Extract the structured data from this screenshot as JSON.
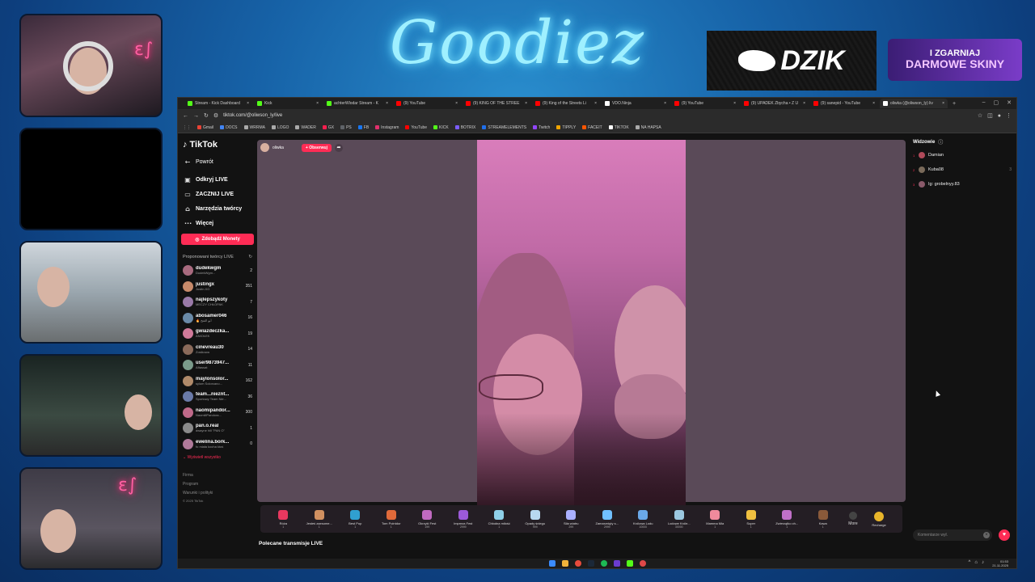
{
  "overlay": {
    "brand": "Goodiez",
    "sponsor": "DZIK",
    "promo_line1": "I ZGARNIAJ",
    "promo_line2": "DARMOWE SKINY",
    "neon_sign": "ɛ∫"
  },
  "browser": {
    "tabs": [
      {
        "label": "Stream - Kick Dashboard",
        "color": "#53fc18"
      },
      {
        "label": "Kick",
        "color": "#53fc18"
      },
      {
        "label": "achterWlodar Stream - K",
        "color": "#53fc18"
      },
      {
        "label": "(9) YouTube",
        "color": "#ff0000"
      },
      {
        "label": "(9) KING OF THE STREE",
        "color": "#ff0000"
      },
      {
        "label": "(9) King of the Streets Li",
        "color": "#ff0000"
      },
      {
        "label": "VDO.Ninja",
        "color": "#ffffff"
      },
      {
        "label": "(9) YouTube",
        "color": "#ff0000"
      },
      {
        "label": "(9) UPADEK Zbycha • Z U",
        "color": "#ff0000"
      },
      {
        "label": "(9) sanepid - YouTube",
        "color": "#ff0000"
      },
      {
        "label": "oliwka (@oliwson_ly) liv",
        "color": "#ffffff"
      }
    ],
    "new_tab": "+",
    "window_controls": [
      "–",
      "▢",
      "✕"
    ],
    "url": "tiktok.com/@oliwson_ly/live",
    "bookmarks": [
      {
        "label": "Gmail",
        "color": "#ea4335"
      },
      {
        "label": "DOCS",
        "color": "#4285f4"
      },
      {
        "label": "WRRMA",
        "color": "#aaaaaa"
      },
      {
        "label": "LOGO",
        "color": "#aaaaaa"
      },
      {
        "label": "WADER",
        "color": "#aaaaaa"
      },
      {
        "label": "GX",
        "color": "#fa1e4e"
      },
      {
        "label": "PS",
        "color": "#5f6368"
      },
      {
        "label": "FB",
        "color": "#1877f2"
      },
      {
        "label": "Instagram",
        "color": "#e1306c"
      },
      {
        "label": "YouTube",
        "color": "#ff0000"
      },
      {
        "label": "KICK",
        "color": "#53fc18"
      },
      {
        "label": "BOTRIX",
        "color": "#7b5cff"
      },
      {
        "label": "STREAMELEMENTS",
        "color": "#1f6feb"
      },
      {
        "label": "Twitch",
        "color": "#9146ff"
      },
      {
        "label": "TIPPLY",
        "color": "#f0a500"
      },
      {
        "label": "FACEIT",
        "color": "#ff5500"
      },
      {
        "label": "TIKTOK",
        "color": "#ffffff"
      },
      {
        "label": "NA HAPSA",
        "color": "#aaaaaa"
      }
    ]
  },
  "tiktok": {
    "logo": "TikTok",
    "back": "Powrót",
    "nav": [
      {
        "label": "Odkryj LIVE",
        "icon": "▣"
      },
      {
        "label": "ZACZNIJ LIVE",
        "icon": "▭"
      },
      {
        "label": "Narzędzia twórcy",
        "icon": "⌂"
      },
      {
        "label": "Więcej",
        "icon": "···"
      }
    ],
    "coins_button": "Zdobądź Monety",
    "suggested_title": "Proponowani twórcy LIVE",
    "creators": [
      {
        "name": "dudekwgm",
        "sub": "DudekWgm...",
        "count": "2"
      },
      {
        "name": "justingx",
        "sub": "Justin.XG",
        "count": "351"
      },
      {
        "name": "najlepszykoty",
        "sub": "MECZY CHŁOPAK",
        "count": "7"
      },
      {
        "name": "abosamer046",
        "sub": "🔥 أبو الفتح",
        "count": "16"
      },
      {
        "name": "gwiazdeczka...",
        "sub": "ANIOŁEK",
        "count": "19"
      },
      {
        "name": "cinevreau30",
        "sub": "Zosikowa",
        "count": "14"
      },
      {
        "name": "user9873947...",
        "sub": "Aftassat",
        "count": "11"
      },
      {
        "name": "maylonsolor...",
        "sub": "sylum Solorcano...",
        "count": "162"
      },
      {
        "name": "team...nieznt...",
        "sub": "Sportowy Team Nie...",
        "count": "36"
      },
      {
        "name": "naomipandor...",
        "sub": "NaomiliPandora...",
        "count": "300"
      },
      {
        "name": "pan.o.real",
        "sub": "dwayne hill \"PAN O\"",
        "count": "1"
      },
      {
        "name": "ewelina.bork...",
        "sub": "fo miała kocha ktoś",
        "count": "0"
      }
    ],
    "see_all": "Wyświetl wszystko",
    "footer": [
      "Firma",
      "Program",
      "Warunki i polityki"
    ],
    "copyright": "© 2025 TikTok",
    "streamer": "oliwka",
    "follow": "+ Obserwuj",
    "gifts": [
      {
        "name": "Róża",
        "price": "1",
        "color": "#e8385f"
      },
      {
        "name": "Jesteś zaesome...",
        "price": "1",
        "color": "#d09060"
      },
      {
        "name": "Best Pop",
        "price": "1",
        "color": "#30a0d0"
      },
      {
        "name": "Tom Pointdor",
        "price": "1",
        "color": "#e06a3a"
      },
      {
        "name": "Okrzyki Fest",
        "price": "199",
        "color": "#c06ac0"
      },
      {
        "name": "Impreza Fest",
        "price": "2999",
        "color": "#9c5ad8"
      },
      {
        "name": "Chłodna miłość",
        "price": "1",
        "color": "#8fd0e8"
      },
      {
        "name": "Opady śniegu",
        "price": "999",
        "color": "#b8d8f0"
      },
      {
        "name": "Siła wiatru",
        "price": "299",
        "color": "#aab0ff"
      },
      {
        "name": "Zamarznięty s...",
        "price": "2999",
        "color": "#70c0ff"
      },
      {
        "name": "Królowa Lodu",
        "price": "10000",
        "color": "#6aa8e8"
      },
      {
        "name": "Lodowe Króle...",
        "price": "30000",
        "color": "#9cc8e0"
      },
      {
        "name": "Mamma Mia",
        "price": "1",
        "color": "#f08a9c"
      },
      {
        "name": "Super",
        "price": "1",
        "color": "#f0c040"
      },
      {
        "name": "Zwierzątko ch...",
        "price": "1",
        "color": "#c070c8"
      },
      {
        "name": "Kawa",
        "price": "1",
        "color": "#8a5a3a"
      }
    ],
    "more": "More",
    "recharge": "Recharge",
    "recommended": "Polecane transmisje LIVE",
    "viewers_title": "Widzowie",
    "viewers": [
      {
        "rank": "1",
        "name": "Damian",
        "value": ""
      },
      {
        "rank": "2",
        "name": "Kuba08",
        "value": "3"
      },
      {
        "rank": "3",
        "name": "Ig: grobelnyy.83",
        "value": ""
      }
    ],
    "comment_placeholder": "Komentarze wył."
  },
  "system": {
    "time": "01:53",
    "date": "21.11.2025"
  }
}
